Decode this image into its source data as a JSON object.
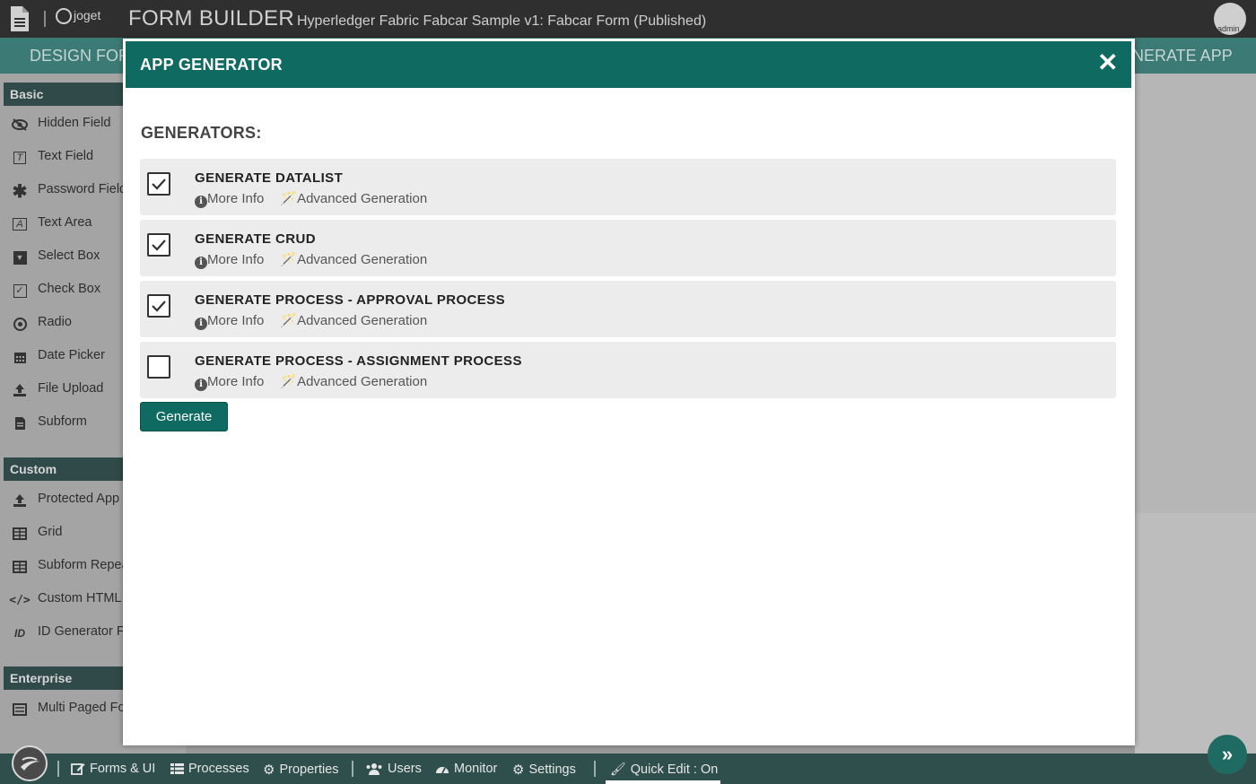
{
  "topbar": {
    "logo_text": "joget",
    "builder_title": "FORM BUILDER",
    "subtitle": "Hyperledger Fabric Fabcar Sample v1: Fabcar Form (Published)",
    "avatar_label": "admin"
  },
  "tabs": {
    "left_label": "DESIGN FOR",
    "right_label": "NERATE APP"
  },
  "sidebar": {
    "basic_title": "Basic",
    "basic_items": [
      {
        "label": "Hidden Field",
        "icon": "eye-slash-icon"
      },
      {
        "label": "Text Field",
        "icon": "text-field-icon"
      },
      {
        "label": "Password Field",
        "icon": "asterisk-icon"
      },
      {
        "label": "Text Area",
        "icon": "text-area-icon"
      },
      {
        "label": "Select Box",
        "icon": "select-box-icon"
      },
      {
        "label": "Check Box",
        "icon": "check-box-icon"
      },
      {
        "label": "Radio",
        "icon": "radio-icon"
      },
      {
        "label": "Date Picker",
        "icon": "calendar-icon"
      },
      {
        "label": "File Upload",
        "icon": "upload-icon"
      },
      {
        "label": "Subform",
        "icon": "file-icon"
      }
    ],
    "custom_title": "Custom",
    "custom_items": [
      {
        "label": "Protected App",
        "icon": "upload-icon"
      },
      {
        "label": "Grid",
        "icon": "table-icon"
      },
      {
        "label": "Subform Repea",
        "icon": "table-icon"
      },
      {
        "label": "Custom HTML",
        "icon": "code-icon"
      },
      {
        "label": "ID Generator F",
        "icon": "id-icon"
      }
    ],
    "enterprise_title": "Enterprise",
    "enterprise_items": [
      {
        "label": "Multi Paged Fo",
        "icon": "list-icon"
      }
    ]
  },
  "modal": {
    "title": "APP GENERATOR",
    "section_title": "GENERATORS:",
    "more_info_label": "More Info",
    "advanced_label": "Advanced Generation",
    "generators": [
      {
        "name": "GENERATE DATALIST",
        "checked": true
      },
      {
        "name": "GENERATE CRUD",
        "checked": true
      },
      {
        "name": "GENERATE PROCESS - APPROVAL PROCESS",
        "checked": true
      },
      {
        "name": "GENERATE PROCESS - ASSIGNMENT PROCESS",
        "checked": false
      }
    ],
    "generate_button": "Generate"
  },
  "bottombar": {
    "forms_ui": "Forms & UI",
    "processes": "Processes",
    "properties": "Properties",
    "users": "Users",
    "monitor": "Monitor",
    "settings": "Settings",
    "quick_edit": "Quick Edit : On"
  },
  "colors": {
    "accent": "#0f6a62",
    "header_bar": "#2f2f2f",
    "bottom_bar": "#2f4f4d"
  }
}
